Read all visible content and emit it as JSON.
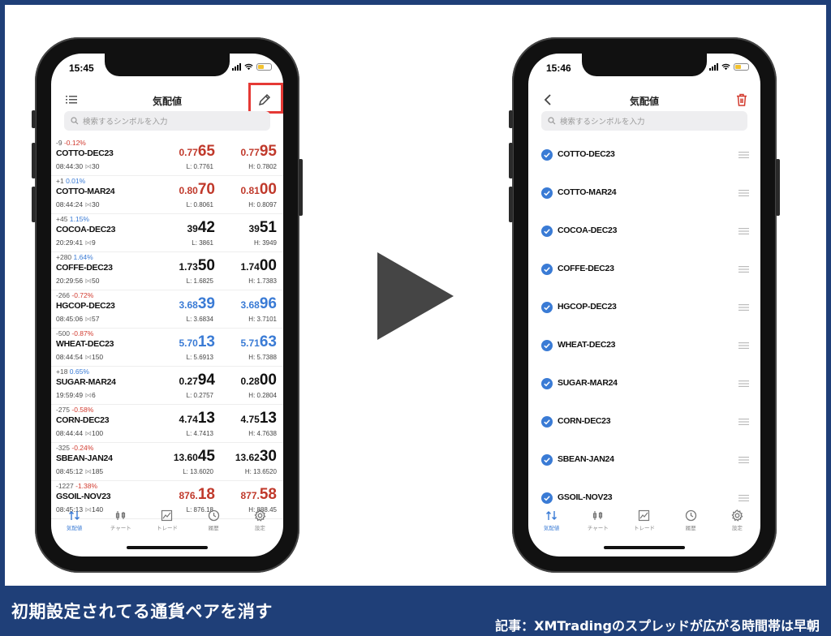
{
  "footer": {
    "title": "初期設定されてる通貨ペアを消す",
    "article": "記事：XMTradingのスプレッドが広がる時間帯は早朝"
  },
  "left_phone": {
    "status_time": "15:45",
    "title": "気配値",
    "search_placeholder": "検索するシンボルを入力",
    "quotes": [
      {
        "change": "-9",
        "pct": "-0.12%",
        "dir": "neg",
        "symbol": "COTTO-DEC23",
        "time": "08:44:30",
        "vol": "30",
        "bid_small": "0.77",
        "bid_big": "65",
        "ask_small": "0.77",
        "ask_big": "95",
        "color": "red",
        "low": "L: 0.7761",
        "high": "H: 0.7802"
      },
      {
        "change": "+1",
        "pct": "0.01%",
        "dir": "pos",
        "symbol": "COTTO-MAR24",
        "time": "08:44:24",
        "vol": "30",
        "bid_small": "0.80",
        "bid_big": "70",
        "ask_small": "0.81",
        "ask_big": "00",
        "color": "red",
        "low": "L: 0.8061",
        "high": "H: 0.8097"
      },
      {
        "change": "+45",
        "pct": "1.15%",
        "dir": "pos",
        "symbol": "COCOA-DEC23",
        "time": "20:29:41",
        "vol": "9",
        "bid_small": "39",
        "bid_big": "42",
        "ask_small": "39",
        "ask_big": "51",
        "color": "black",
        "low": "L: 3861",
        "high": "H: 3949"
      },
      {
        "change": "+280",
        "pct": "1.64%",
        "dir": "pos",
        "symbol": "COFFE-DEC23",
        "time": "20:29:56",
        "vol": "50",
        "bid_small": "1.73",
        "bid_big": "50",
        "ask_small": "1.74",
        "ask_big": "00",
        "color": "black",
        "low": "L: 1.6825",
        "high": "H: 1.7383"
      },
      {
        "change": "-266",
        "pct": "-0.72%",
        "dir": "neg",
        "symbol": "HGCOP-DEC23",
        "time": "08:45:06",
        "vol": "57",
        "bid_small": "3.68",
        "bid_big": "39",
        "ask_small": "3.68",
        "ask_big": "96",
        "color": "blue",
        "low": "L: 3.6834",
        "high": "H: 3.7101"
      },
      {
        "change": "-500",
        "pct": "-0.87%",
        "dir": "neg",
        "symbol": "WHEAT-DEC23",
        "time": "08:44:54",
        "vol": "150",
        "bid_small": "5.70",
        "bid_big": "13",
        "ask_small": "5.71",
        "ask_big": "63",
        "color": "blue",
        "low": "L: 5.6913",
        "high": "H: 5.7388"
      },
      {
        "change": "+18",
        "pct": "0.65%",
        "dir": "pos",
        "symbol": "SUGAR-MAR24",
        "time": "19:59:49",
        "vol": "6",
        "bid_small": "0.27",
        "bid_big": "94",
        "ask_small": "0.28",
        "ask_big": "00",
        "color": "black",
        "low": "L: 0.2757",
        "high": "H: 0.2804"
      },
      {
        "change": "-275",
        "pct": "-0.58%",
        "dir": "neg",
        "symbol": "CORN-DEC23",
        "time": "08:44:44",
        "vol": "100",
        "bid_small": "4.74",
        "bid_big": "13",
        "ask_small": "4.75",
        "ask_big": "13",
        "color": "black",
        "low": "L: 4.7413",
        "high": "H: 4.7638"
      },
      {
        "change": "-325",
        "pct": "-0.24%",
        "dir": "neg",
        "symbol": "SBEAN-JAN24",
        "time": "08:45:12",
        "vol": "185",
        "bid_small": "13.60",
        "bid_big": "45",
        "ask_small": "13.62",
        "ask_big": "30",
        "color": "black",
        "low": "L: 13.6020",
        "high": "H: 13.6520"
      },
      {
        "change": "-1227",
        "pct": "-1.38%",
        "dir": "neg",
        "symbol": "GSOIL-NOV23",
        "time": "08:45:13",
        "vol": "140",
        "bid_small": "876.",
        "bid_big": "18",
        "ask_small": "877.",
        "ask_big": "58",
        "color": "red",
        "low": "L: 876.18",
        "high": "H: 888.45"
      }
    ]
  },
  "right_phone": {
    "status_time": "15:46",
    "title": "気配値",
    "search_placeholder": "検索するシンボルを入力",
    "symbols": [
      "COTTO-DEC23",
      "COTTO-MAR24",
      "COCOA-DEC23",
      "COFFE-DEC23",
      "HGCOP-DEC23",
      "WHEAT-DEC23",
      "SUGAR-MAR24",
      "CORN-DEC23",
      "SBEAN-JAN24",
      "GSOIL-NOV23"
    ]
  },
  "tabs": [
    "気配値",
    "チャート",
    "トレード",
    "履歴",
    "設定"
  ],
  "colors": {
    "frame": "#1f3f78",
    "accent": "#3a7bd5",
    "down": "#d23b2f",
    "highlight": "#e53935"
  },
  "icons": {
    "left_nav": "list-icon",
    "edit": "pencil-icon",
    "back": "chevron-left-icon",
    "delete": "trash-icon",
    "arrow": "play-arrow-icon"
  }
}
